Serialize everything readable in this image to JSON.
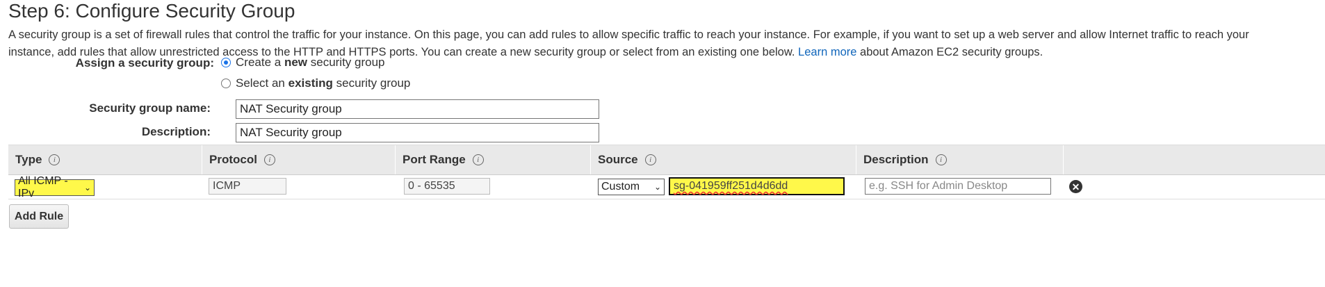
{
  "page": {
    "title": "Step 6: Configure Security Group",
    "intro_line1": "A security group is a set of firewall rules that control the traffic for your instance. On this page, you can add rules to allow specific traffic to reach your instance. For example, if you want to set up a web server and allow Internet traffic to reach your",
    "intro_line2_pre": "instance, add rules that allow unrestricted access to the HTTP and HTTPS ports. You can create a new security group or select from an existing one below.",
    "learn_more": "Learn more",
    "intro_line2_post": "about Amazon EC2 security groups."
  },
  "assign": {
    "label": "Assign a security group:",
    "option_new_pre": "Create a",
    "option_new_bold": "new",
    "option_new_post": "security group",
    "option_existing_pre": "Select an",
    "option_existing_bold": "existing",
    "option_existing_post": "security group",
    "selected": "new"
  },
  "form": {
    "name_label": "Security group name:",
    "name_value": "NAT Security group",
    "description_label": "Description:",
    "description_value": "NAT Security group"
  },
  "rules_table": {
    "columns": [
      "Type",
      "Protocol",
      "Port Range",
      "Source",
      "Description"
    ],
    "rows": [
      {
        "type": "All ICMP - IPv",
        "protocol": "ICMP",
        "port_range": "0 - 65535",
        "source_mode": "Custom",
        "source_value": "sg-041959ff251d4d6dd",
        "description_placeholder": "e.g. SSH for Admin Desktop"
      }
    ]
  },
  "buttons": {
    "add_rule": "Add Rule"
  },
  "colors": {
    "highlight": "#fff84a",
    "link": "#1166bb",
    "header_bg": "#e9e9e9"
  },
  "icons": [
    "info-icon",
    "chevron-down-icon",
    "remove-rule-icon"
  ]
}
